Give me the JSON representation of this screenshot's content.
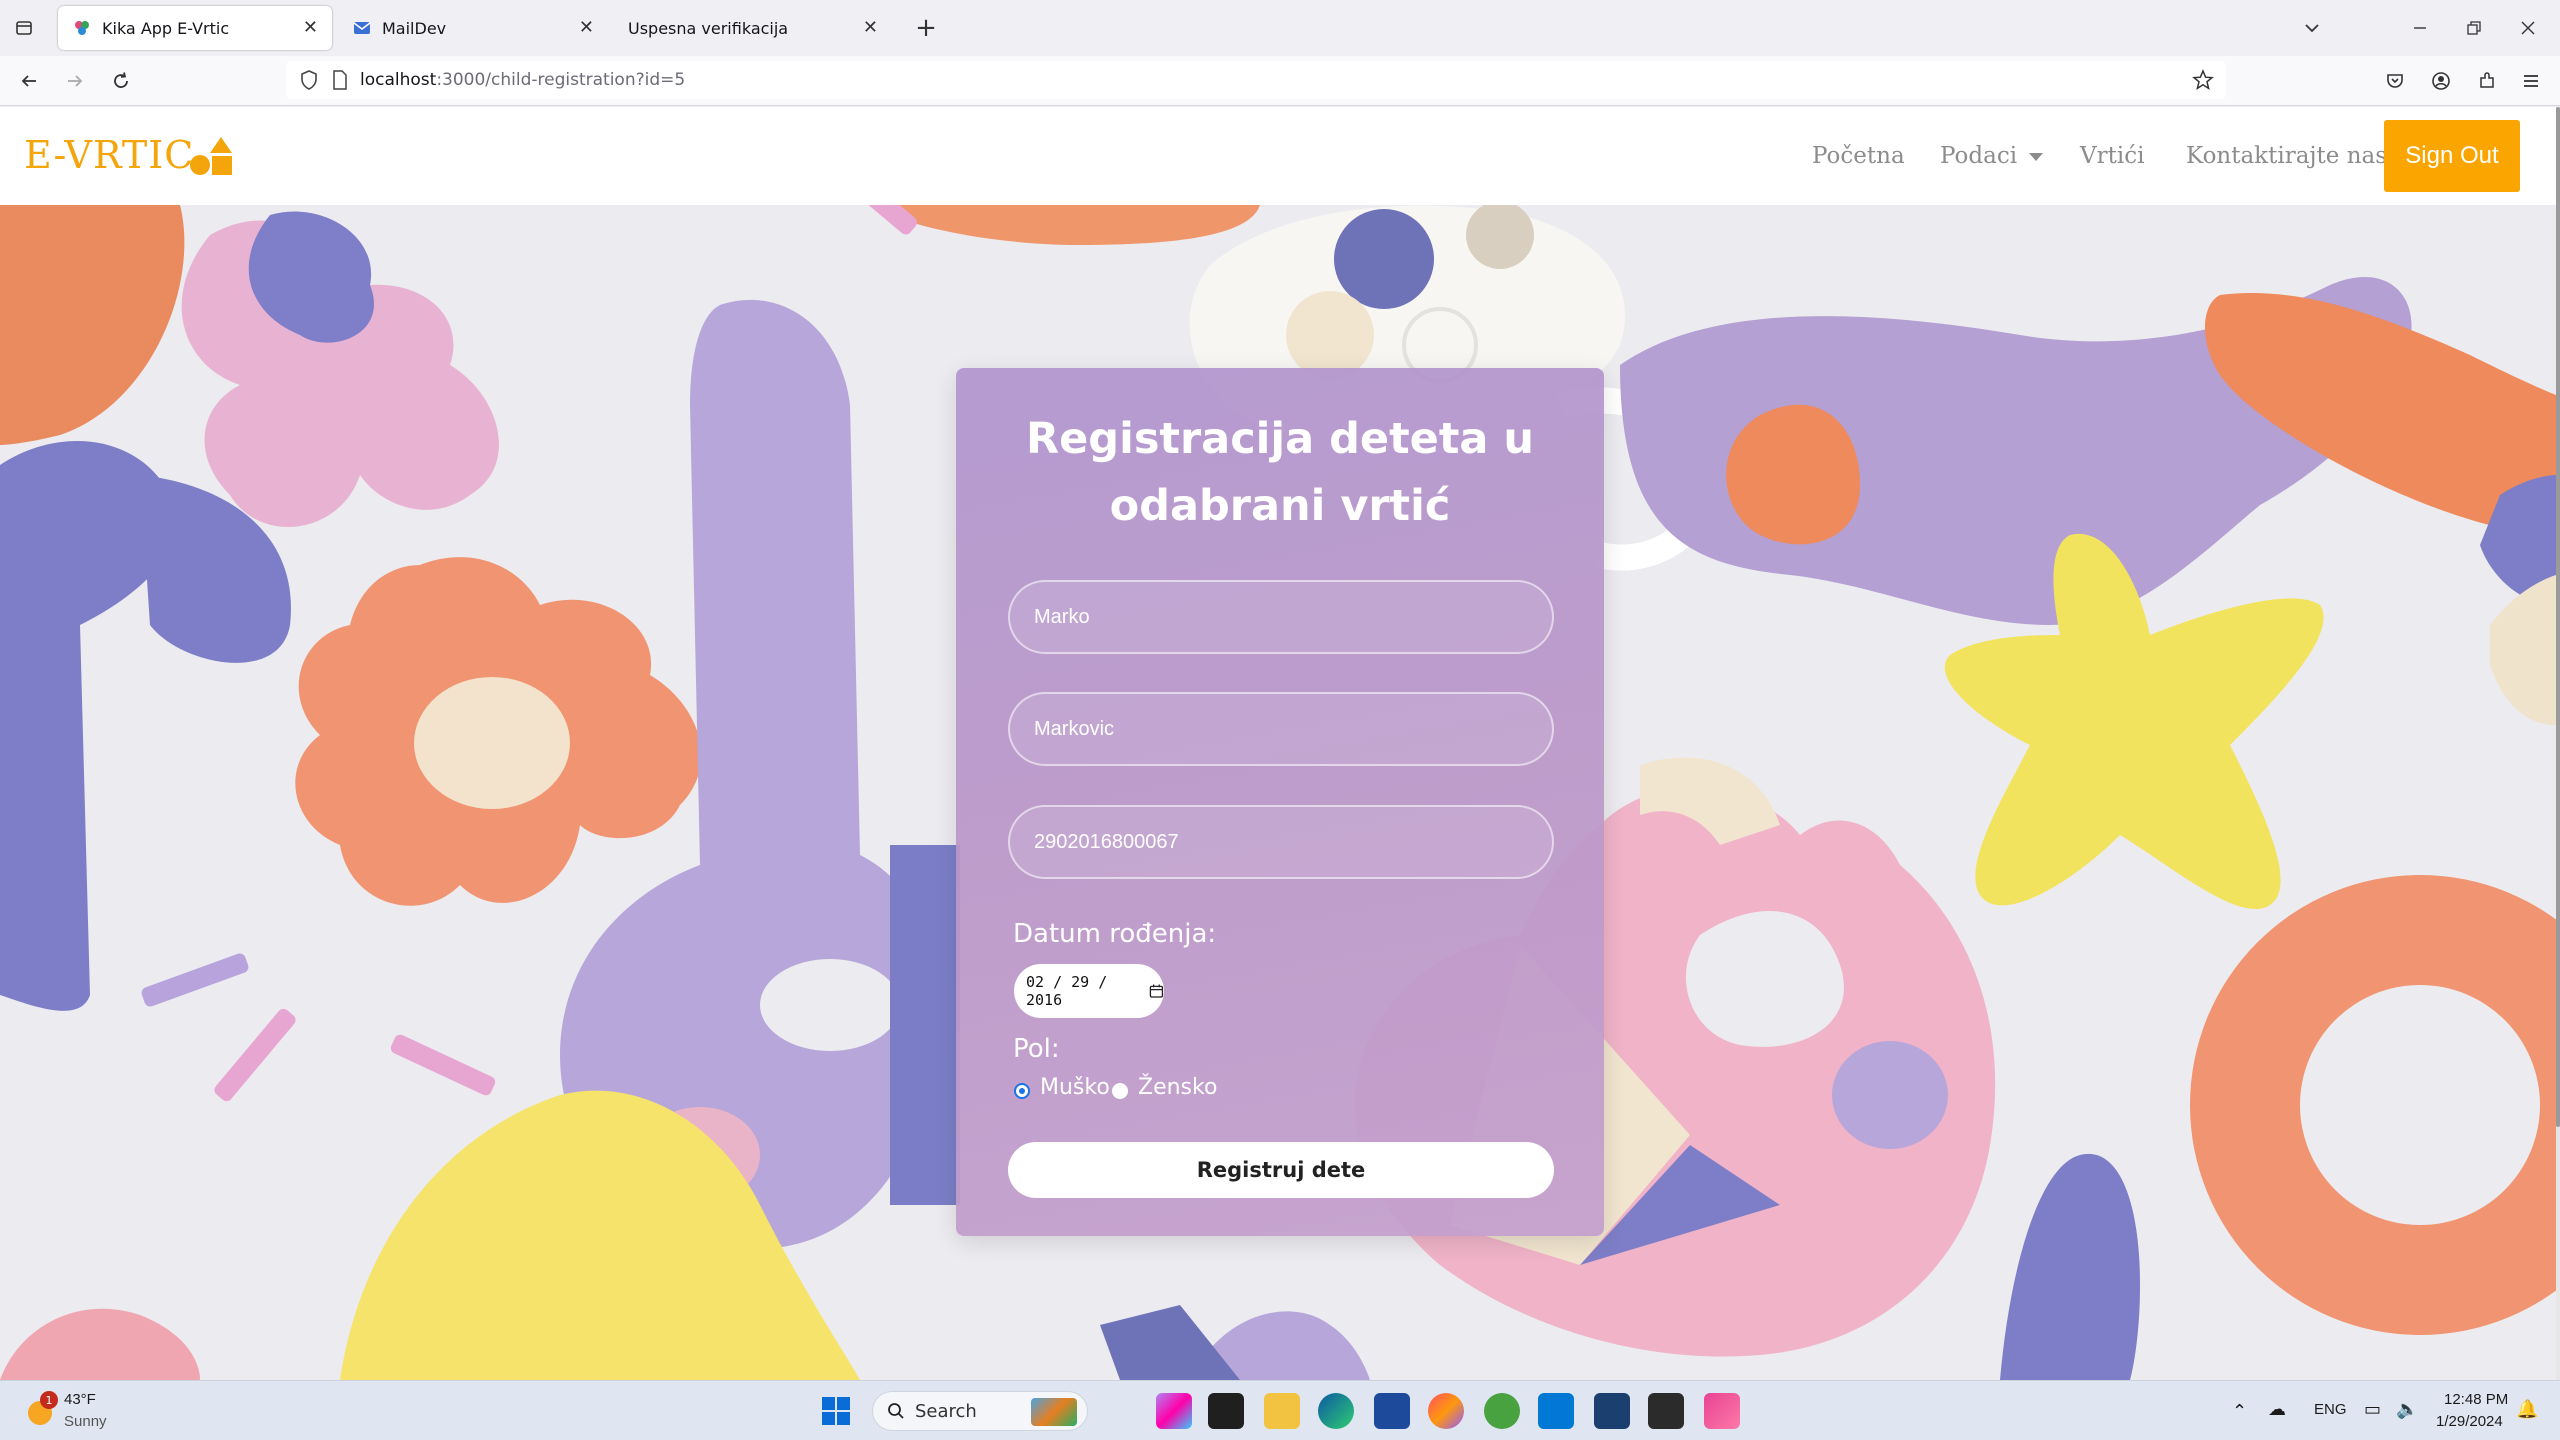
{
  "browser": {
    "tabs": [
      {
        "label": "Kika App E-Vrtic",
        "active": true
      },
      {
        "label": "MailDev",
        "active": false
      },
      {
        "label": "Uspesna verifikacija",
        "active": false
      }
    ],
    "url_host": "localhost",
    "url_path": ":3000/child-registration?id=5"
  },
  "site": {
    "logo": "E-VRTIC",
    "nav": {
      "home": "Početna",
      "data": "Podaci",
      "kindergartens": "Vrtići",
      "contact": "Kontaktirajte nas"
    },
    "signout": "Sign Out",
    "accent_color": "#fba600"
  },
  "form": {
    "title_line1": "Registracija deteta u",
    "title_line2": "odabrani vrtić",
    "first_name": "Marko",
    "last_name": "Markovic",
    "jmbg": "2902016800067",
    "dob_label": "Datum rođenja:",
    "dob_value": "02 / 29 / 2016",
    "gender_label": "Pol:",
    "gender_male": "Muško",
    "gender_female": "Žensko",
    "gender_selected": "male",
    "submit": "Registruj dete"
  },
  "taskbar": {
    "weather_temp": "43°F",
    "weather_desc": "Sunny",
    "weather_badge": "1",
    "search": "Search",
    "lang": "ENG",
    "time": "12:48 PM",
    "date": "1/29/2024"
  }
}
